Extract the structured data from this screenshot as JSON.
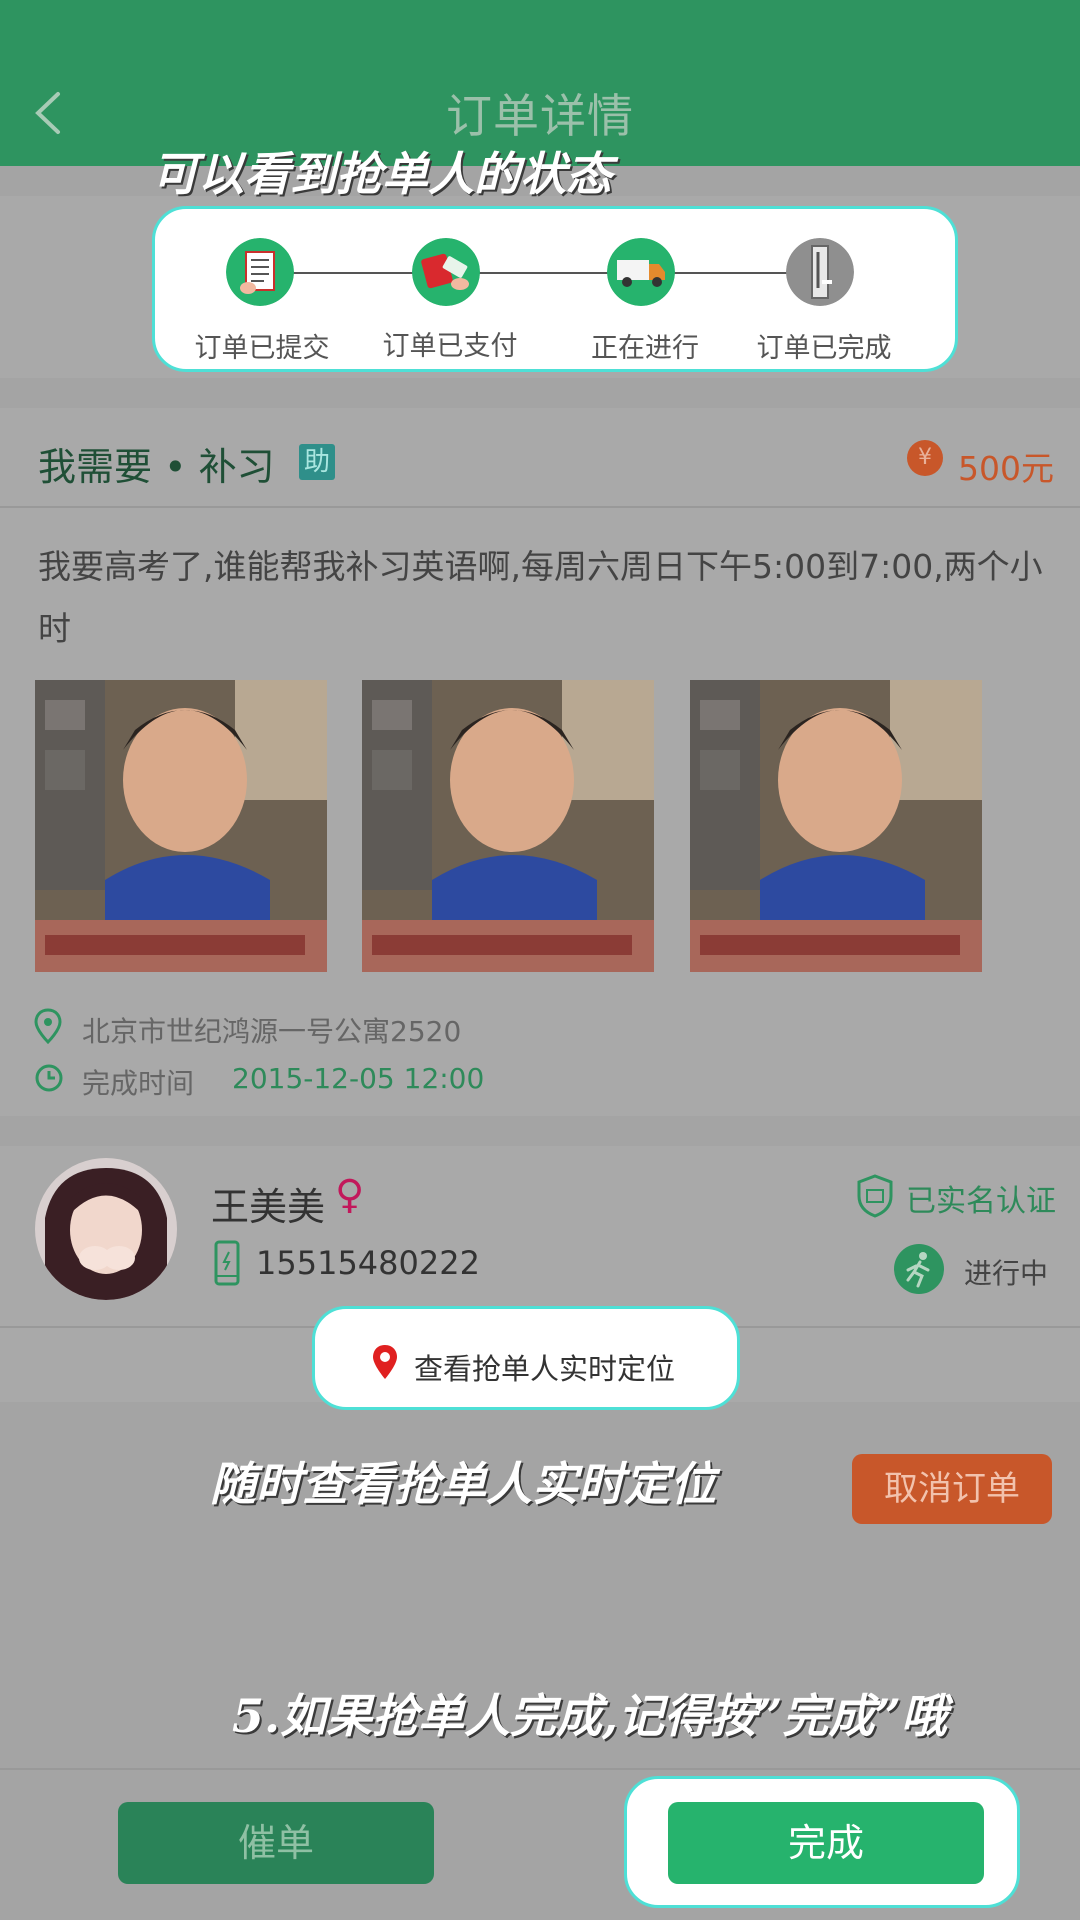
{
  "header": {
    "title": "订单详情"
  },
  "annotations": {
    "status_tip": "可以看到抢单人的状态",
    "location_tip": "随时查看抢单人实时定位",
    "complete_tip": "5.如果抢单人完成,记得按”完成”哦"
  },
  "steps": [
    {
      "label": "订单已提交",
      "icon": "document-icon"
    },
    {
      "label": "订单已支付",
      "icon": "payment-icon"
    },
    {
      "label": "正在进行",
      "icon": "truck-icon"
    },
    {
      "label": "订单已完成",
      "icon": "completed-icon"
    }
  ],
  "order": {
    "title": "我需要 • 补习",
    "badge": "助",
    "price_symbol": "¥",
    "price": "500元",
    "description": "我要高考了,谁能帮我补习英语啊,每周六周日下午5:00到7:00,两个小时",
    "address": "北京市世纪鸿源一号公寓2520",
    "time_label": "完成时间",
    "time_value": "2015-12-05 12:00",
    "photo_count": 3
  },
  "grabber": {
    "name": "王美美",
    "gender_symbol": "♀",
    "phone": "15515480222",
    "verified": "已实名认证",
    "status": "进行中"
  },
  "location_button": "查看抢单人实时定位",
  "cancel_button": "取消订单",
  "footer": {
    "urge_button": "催单",
    "complete_button": "完成"
  },
  "colors": {
    "header_green": "#2e9460",
    "accent_green": "#26b36d",
    "price_orange": "#c8572a",
    "highlight_cyan": "#4ee0d6"
  }
}
